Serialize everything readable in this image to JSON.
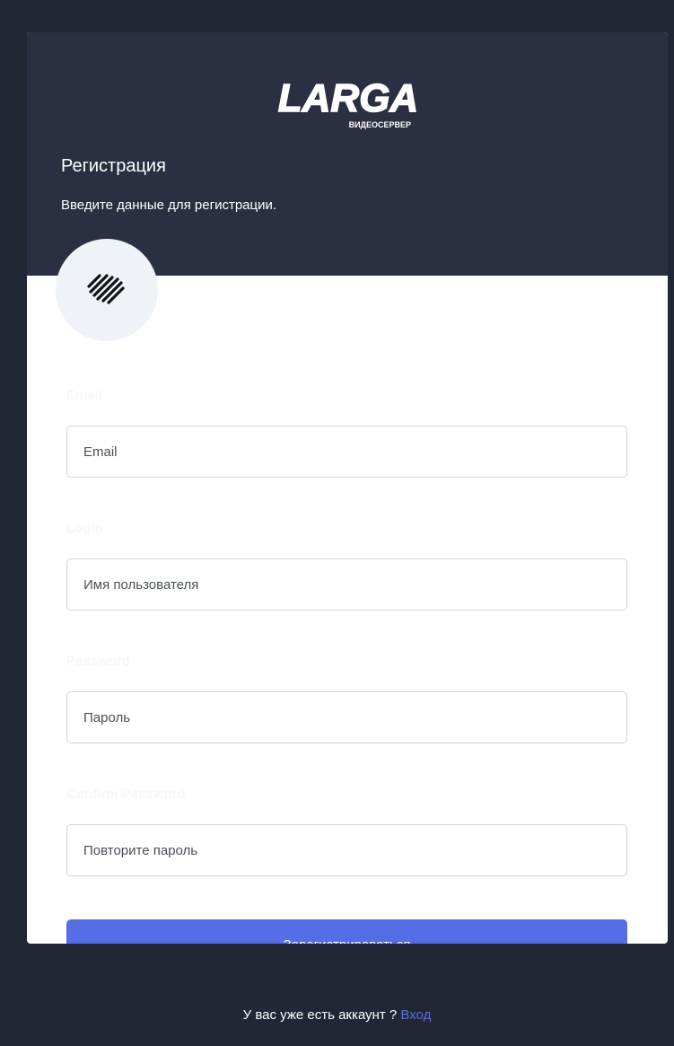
{
  "logo": {
    "brand": "LARGA",
    "tagline": "ВИДЕОСЕРВЕР"
  },
  "header": {
    "title": "Регистрация",
    "subtitle": "Введите данные для регистрации."
  },
  "avatar": {
    "icon": "diagonal-stripes-icon"
  },
  "form": {
    "fields": [
      {
        "label": "Email",
        "placeholder": "Email",
        "value": ""
      },
      {
        "label": "Login",
        "placeholder": "Имя пользователя",
        "value": ""
      },
      {
        "label": "Password",
        "placeholder": "Пароль",
        "value": ""
      },
      {
        "label": "Confirm Password",
        "placeholder": "Повторите пароль",
        "value": ""
      }
    ],
    "submit_label": "Зарегистрироваться"
  },
  "footer": {
    "prompt": "У вас уже есть аккаунт ? ",
    "login_link": "Вход"
  },
  "colors": {
    "page_background": "#222736",
    "header_background": "#2a3042",
    "primary": "#556ee6",
    "avatar_background": "#eff2f7"
  }
}
